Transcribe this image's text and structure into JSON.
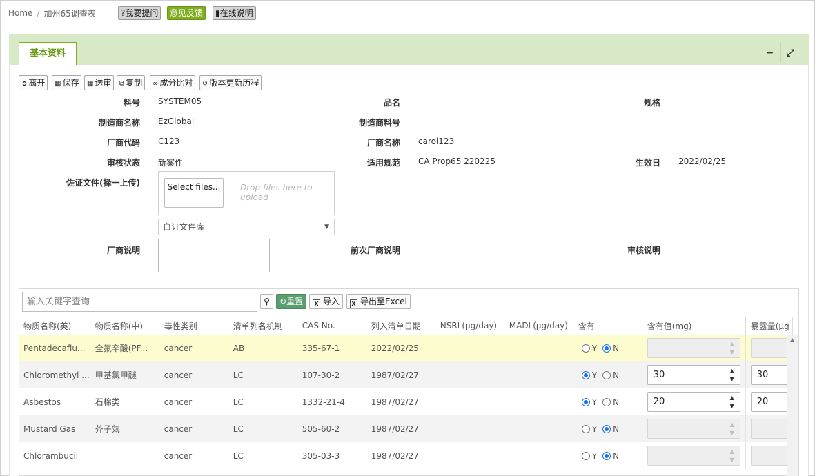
{
  "breadcrumb": {
    "home": "Home",
    "sep": "/",
    "current": "加州65调查表"
  },
  "top_buttons": {
    "ask": "?我要提问",
    "feedback": "意见反馈",
    "online_help": "在线说明"
  },
  "panel": {
    "tab": "基本资料",
    "minimize": "━",
    "expand": "⤢"
  },
  "actions": {
    "leave": "离开",
    "save": "保存",
    "submit": "送审",
    "copy": "复制",
    "compare": "成分比对",
    "history": "版本更新历程"
  },
  "form": {
    "part_no_label": "料号",
    "part_no": "SYSTEM05",
    "product_name_label": "品名",
    "spec_label": "规格",
    "manufacturer_label": "制造商名称",
    "manufacturer": "EzGlobal",
    "mfr_part_label": "制造商料号",
    "vendor_code_label": "厂商代码",
    "vendor_code": "C123",
    "vendor_name_label": "厂商名称",
    "vendor_name": "carol123",
    "review_status_label": "审核状态",
    "review_status": "新案件",
    "regulation_label": "适用规范",
    "regulation": "CA Prop65 220225",
    "effective_label": "生效日",
    "effective": "2022/02/25",
    "evidence_label": "佐证文件(择一上传)",
    "select_files": "Select files...",
    "drop_hint": "Drop files here to upload",
    "library": "自订文件库",
    "vendor_note_label": "厂商说明",
    "prev_vendor_note_label": "前次厂商说明",
    "review_note_label": "审核说明"
  },
  "grid_toolbar": {
    "search_placeholder": "输入关键字查询",
    "reset": "重置",
    "import": "导入",
    "export": "导出至Excel"
  },
  "columns": [
    "物质名称(英)",
    "物质名称(中)",
    "毒性类别",
    "清单列名机制",
    "CAS No.",
    "列入清单日期",
    "NSRL(μg/day)",
    "MADL(μg/day)",
    "含有",
    "含有值(mg)",
    "暴露量(μg"
  ],
  "rows": [
    {
      "en": "Pentadecaflu...",
      "zh": "全氟辛酸(PF...",
      "tox": "cancer",
      "mech": "AB",
      "cas": "335-67-1",
      "date": "2022/02/25",
      "nsrl": "",
      "madl": "",
      "contains": "N",
      "value": "",
      "exposure": ""
    },
    {
      "en": "Chloromethyl ...",
      "zh": "甲基氯甲醚",
      "tox": "cancer",
      "mech": "LC",
      "cas": "107-30-2",
      "date": "1987/02/27",
      "nsrl": "",
      "madl": "",
      "contains": "Y",
      "value": "30",
      "exposure": "30"
    },
    {
      "en": "Asbestos",
      "zh": "石棉类",
      "tox": "cancer",
      "mech": "LC",
      "cas": "1332-21-4",
      "date": "1987/02/27",
      "nsrl": "",
      "madl": "",
      "contains": "Y",
      "value": "20",
      "exposure": "20"
    },
    {
      "en": "Mustard Gas",
      "zh": "芥子氣",
      "tox": "cancer",
      "mech": "LC",
      "cas": "505-60-2",
      "date": "1987/02/27",
      "nsrl": "",
      "madl": "",
      "contains": "N",
      "value": "",
      "exposure": ""
    },
    {
      "en": "Chlorambucil",
      "zh": "",
      "tox": "cancer",
      "mech": "LC",
      "cas": "305-03-3",
      "date": "1987/02/27",
      "nsrl": "",
      "madl": "",
      "contains": "N",
      "value": "",
      "exposure": ""
    }
  ],
  "radio_labels": {
    "yes": "Y",
    "no": "N"
  },
  "colors": {
    "accent": "#7fae1f",
    "header_band": "#d7e9c7",
    "highlight_row": "#fcfccf",
    "reset_button": "#5b9e6e"
  }
}
